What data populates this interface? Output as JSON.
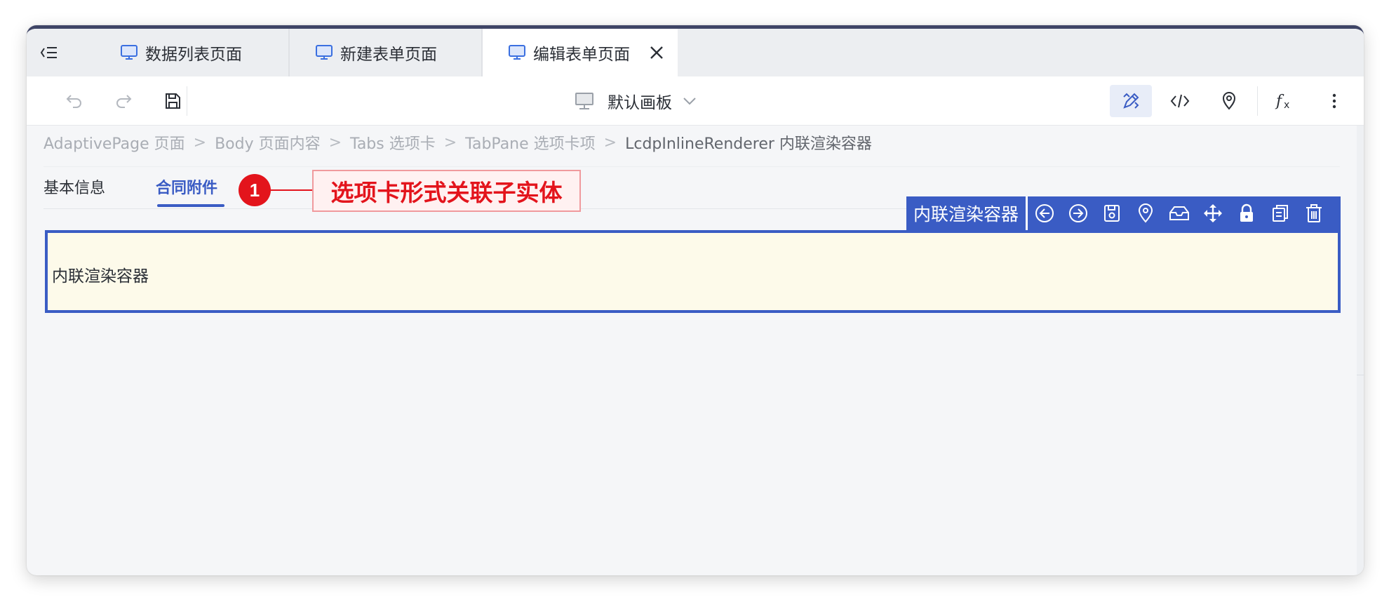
{
  "tabs": [
    {
      "label": "数据列表页面",
      "icon": "monitor-icon",
      "active": false
    },
    {
      "label": "新建表单页面",
      "icon": "monitor-icon",
      "active": false
    },
    {
      "label": "编辑表单页面",
      "icon": "monitor-icon",
      "active": true
    }
  ],
  "toolbar": {
    "board_label": "默认画板",
    "left_icons": [
      "undo-icon",
      "redo-icon",
      "save-icon"
    ],
    "right_icons": [
      "design-icon",
      "code-icon",
      "location-pin-icon",
      "function-icon",
      "more-vertical-icon"
    ]
  },
  "breadcrumb": [
    "AdaptivePage 页面",
    "Body 页面内容",
    "Tabs 选项卡",
    "TabPane 选项卡项",
    "LcdpInlineRenderer 内联渲染容器"
  ],
  "breadcrumb_separator": ">",
  "content_tabs": [
    {
      "label": "基本信息",
      "active": false
    },
    {
      "label": "合同附件",
      "active": true
    }
  ],
  "annotation": {
    "number": "1",
    "text": "选项卡形式关联子实体",
    "color": "#e3141c"
  },
  "component_bar": {
    "title": "内联渲染容器",
    "actions": [
      "arrow-left-circle-icon",
      "arrow-right-circle-icon",
      "save-icon",
      "location-pin-icon",
      "inbox-icon",
      "move-icon",
      "lock-icon",
      "copy-icon",
      "trash-icon"
    ]
  },
  "renderer": {
    "label": "内联渲染容器"
  },
  "colors": {
    "accent": "#3a5cc4",
    "renderer_bg": "#fdfaea",
    "title_bar": "#3f4566"
  }
}
